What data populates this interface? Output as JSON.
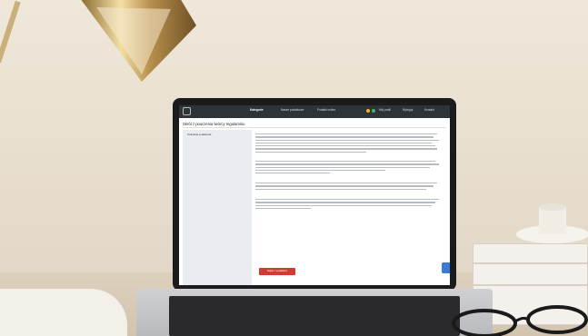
{
  "nav": {
    "items": [
      "Kategorie",
      "Nasze podatkowe",
      "Podatki online"
    ],
    "active_index": 0,
    "right_items": [
      "Mój profil",
      "Wyloguj",
      "Kontakt"
    ]
  },
  "page": {
    "title": "Skrót z pouczenia twórcy regulaminu",
    "sidebar_label": "Instrukcja podatkowa",
    "action_button": "Zapisz z podatkiem"
  },
  "colors": {
    "nav_bg": "#2e3338",
    "button": "#d33a32",
    "chat_widget": "#3a7bd5",
    "dot_yellow": "#e8b923",
    "dot_green": "#3cb371"
  }
}
